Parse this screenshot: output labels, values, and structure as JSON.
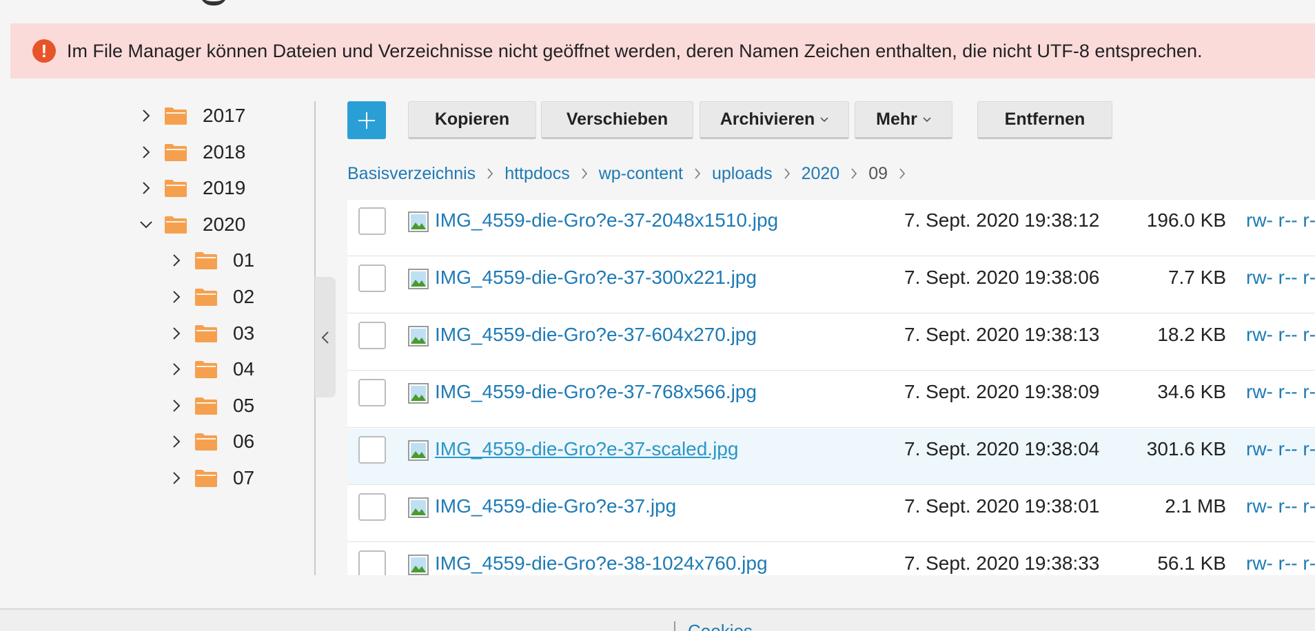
{
  "alert": {
    "text": "Im File Manager können Dateien und Verzeichnisse nicht geöffnet werden, deren Namen Zeichen enthalten, die nicht UTF-8 entsprechen.",
    "icon": "exclamation-icon",
    "color": "#e8542a",
    "background": "#fbdada"
  },
  "tree": {
    "items": [
      {
        "label": "2017",
        "expanded": false,
        "level": 1
      },
      {
        "label": "2018",
        "expanded": false,
        "level": 1
      },
      {
        "label": "2019",
        "expanded": false,
        "level": 1
      },
      {
        "label": "2020",
        "expanded": true,
        "level": 1
      },
      {
        "label": "01",
        "expanded": false,
        "level": 2
      },
      {
        "label": "02",
        "expanded": false,
        "level": 2
      },
      {
        "label": "03",
        "expanded": false,
        "level": 2
      },
      {
        "label": "04",
        "expanded": false,
        "level": 2
      },
      {
        "label": "05",
        "expanded": false,
        "level": 2
      },
      {
        "label": "06",
        "expanded": false,
        "level": 2
      },
      {
        "label": "07",
        "expanded": false,
        "level": 2
      }
    ],
    "folder_color": "#f5a04f"
  },
  "toolbar": {
    "add_icon": "plus-icon",
    "copy_label": "Kopieren",
    "move_label": "Verschieben",
    "archive_label": "Archivieren",
    "more_label": "Mehr",
    "remove_label": "Entfernen",
    "accent": "#2a9fd6"
  },
  "breadcrumb": {
    "items": [
      "Basisverzeichnis",
      "httpdocs",
      "wp-content",
      "uploads",
      "2020",
      "09"
    ]
  },
  "files": [
    {
      "name": "IMG_4559-die-Gro?e-37-2048x1510.jpg",
      "date": "7. Sept. 2020 19:38:12",
      "size": "196.0 KB",
      "perm": "rw- r-- r--"
    },
    {
      "name": "IMG_4559-die-Gro?e-37-300x221.jpg",
      "date": "7. Sept. 2020 19:38:06",
      "size": "7.7 KB",
      "perm": "rw- r-- r--"
    },
    {
      "name": "IMG_4559-die-Gro?e-37-604x270.jpg",
      "date": "7. Sept. 2020 19:38:13",
      "size": "18.2 KB",
      "perm": "rw- r-- r--"
    },
    {
      "name": "IMG_4559-die-Gro?e-37-768x566.jpg",
      "date": "7. Sept. 2020 19:38:09",
      "size": "34.6 KB",
      "perm": "rw- r-- r--"
    },
    {
      "name": "IMG_4559-die-Gro?e-37-scaled.jpg",
      "date": "7. Sept. 2020 19:38:04",
      "size": "301.6 KB",
      "perm": "rw- r-- r--",
      "hover": true
    },
    {
      "name": "IMG_4559-die-Gro?e-37.jpg",
      "date": "7. Sept. 2020 19:38:01",
      "size": "2.1 MB",
      "perm": "rw- r-- r--"
    },
    {
      "name": "IMG_4559-die-Gro?e-38-1024x760.jpg",
      "date": "7. Sept. 2020 19:38:33",
      "size": "56.1 KB",
      "perm": "rw- r-- r--"
    }
  ],
  "footer": {
    "link": "Cookies"
  }
}
